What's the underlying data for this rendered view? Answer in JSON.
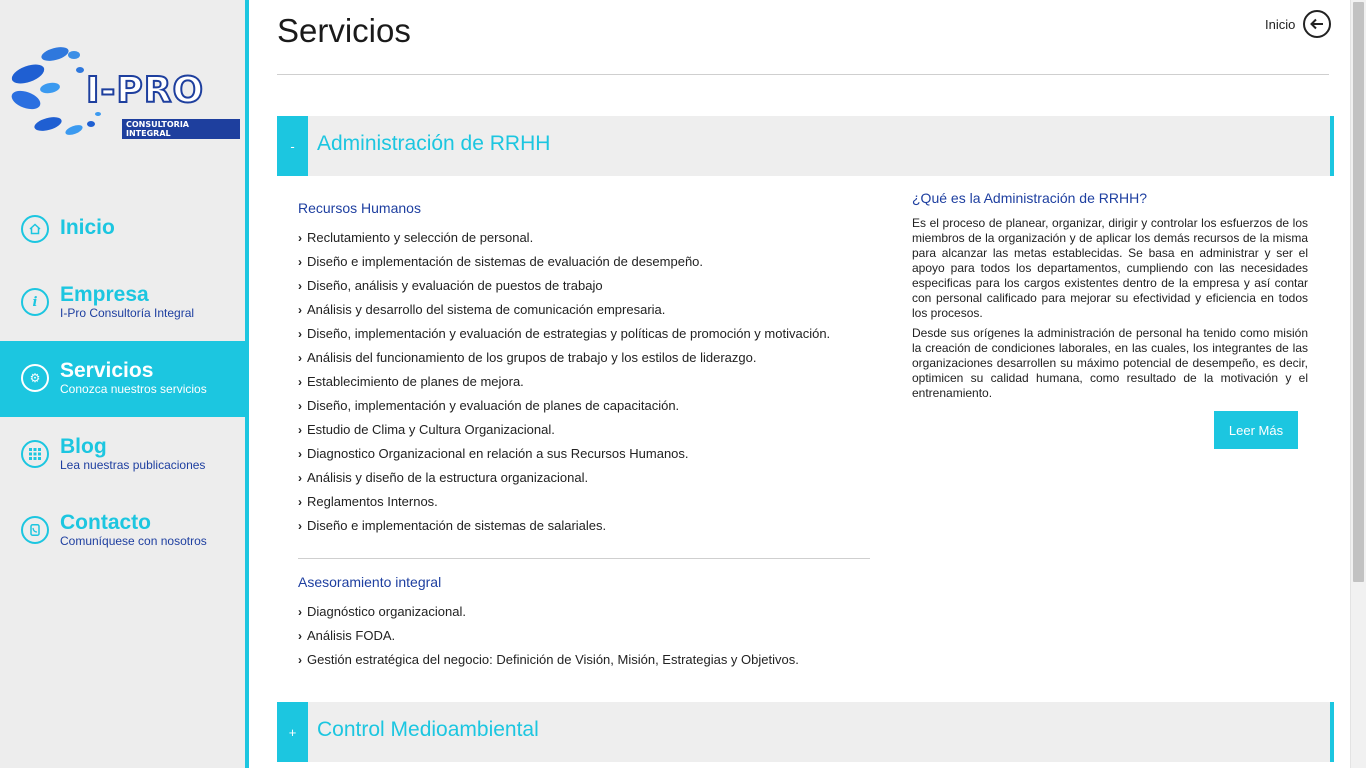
{
  "brand": {
    "logo_text": "I-PRO",
    "logo_subtitle": "CONSULTORIA INTEGRAL"
  },
  "nav": {
    "items": [
      {
        "title": "Inicio",
        "subtitle": "",
        "icon": "home-icon"
      },
      {
        "title": "Empresa",
        "subtitle": "I-Pro Consultoría Integral",
        "icon": "info-icon"
      },
      {
        "title": "Servicios",
        "subtitle": "Conozca nuestros servicios",
        "icon": "gears-icon",
        "active": true
      },
      {
        "title": "Blog",
        "subtitle": "Lea nuestras publicaciones",
        "icon": "grid-icon"
      },
      {
        "title": "Contacto",
        "subtitle": "Comuníquese con nosotros",
        "icon": "phone-icon"
      }
    ]
  },
  "header": {
    "title": "Servicios",
    "home_label": "Inicio"
  },
  "accordion": [
    {
      "toggle": "-",
      "title": "Administración de RRHH",
      "expanded": true
    },
    {
      "toggle": "+",
      "title": "Control Medioambiental",
      "expanded": false
    }
  ],
  "rrhh": {
    "section1_title": "Recursos Humanos",
    "section1_items": [
      "Reclutamiento y selección de personal.",
      "Diseño e implementación de sistemas de evaluación de desempeño.",
      "Diseño, análisis y evaluación de puestos de trabajo",
      "Análisis y desarrollo del sistema de comunicación empresaria.",
      "Diseño, implementación y evaluación de estrategias y políticas de promoción y motivación.",
      "Análisis del funcionamiento de los grupos de trabajo y los estilos de liderazgo.",
      "Establecimiento de planes de mejora.",
      "Diseño, implementación y evaluación de planes de capacitación.",
      "Estudio de Clima y Cultura Organizacional.",
      "Diagnostico Organizacional en relación a sus Recursos Humanos.",
      "Análisis y diseño de la estructura organizacional.",
      "Reglamentos Internos.",
      "Diseño e implementación de sistemas de salariales."
    ],
    "section2_title": "Asesoramiento integral",
    "section2_items": [
      "Diagnóstico organizacional.",
      "Análisis FODA.",
      "Gestión estratégica del negocio: Definición de Visión, Misión, Estrategias y Objetivos."
    ],
    "info_title": "¿Qué es la Administración de RRHH?",
    "info_para1": "Es el proceso de planear, organizar, dirigir y controlar los esfuerzos de los miembros de la organización y de aplicar los demás recursos de la misma para alcanzar las metas establecidas. Se basa en administrar y ser el apoyo para todos los departamentos, cumpliendo con las necesidades especificas para los cargos existentes dentro de la empresa y así contar con personal calificado para mejorar su efectividad y eficiencia en todos los procesos.",
    "info_para2": "Desde sus orígenes la administración de personal ha tenido como misión la creación de condiciones laborales, en las cuales, los integrantes de las organizaciones desarrollen su máximo potencial de desempeño, es decir, optimicen su calidad humana, como resultado de la motivación y el entrenamiento.",
    "read_more": "Leer Más"
  },
  "colors": {
    "accent": "#1cc6e0",
    "navy": "#1e3fa0",
    "panel": "#eeeeee"
  }
}
